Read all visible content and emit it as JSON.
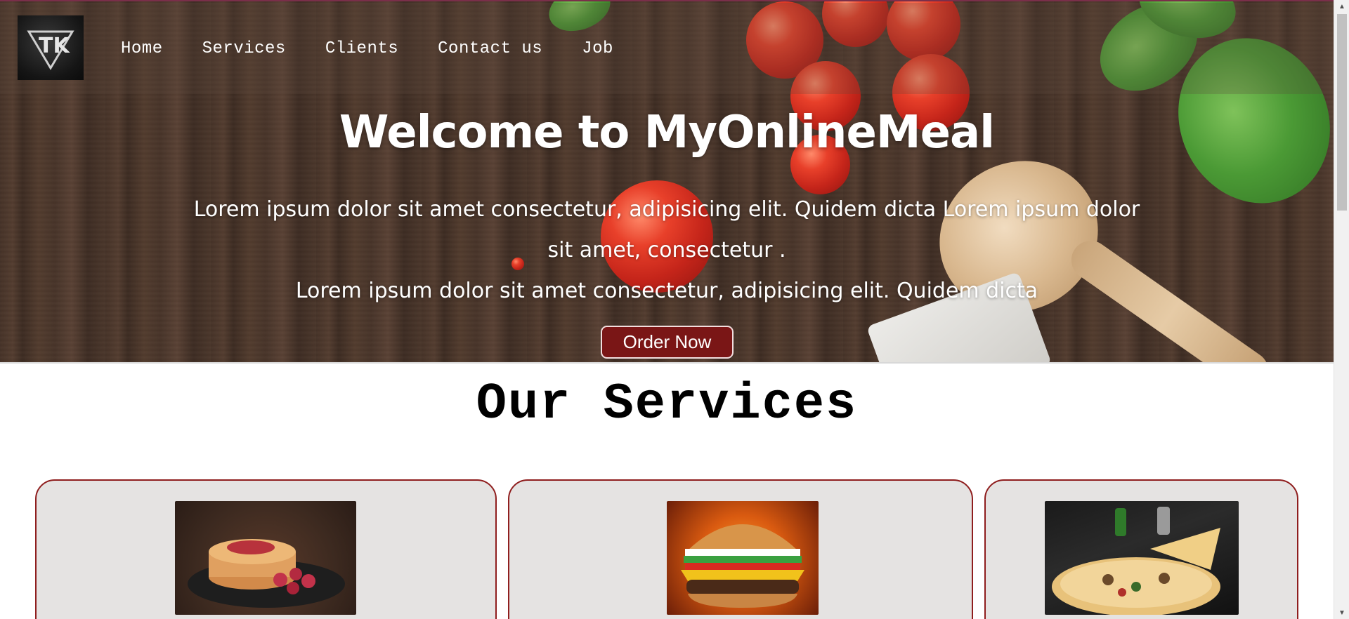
{
  "brand": {
    "logo_text": "TK",
    "logo_icon": "triangle-tk-logo"
  },
  "nav": {
    "items": [
      {
        "label": "Home"
      },
      {
        "label": "Services"
      },
      {
        "label": "Clients"
      },
      {
        "label": "Contact us"
      },
      {
        "label": "Job"
      }
    ]
  },
  "hero": {
    "title": "Welcome to MyOnlineMeal",
    "line1": "Lorem ipsum dolor sit amet consectetur, adipisicing elit. Quidem dicta Lorem ipsum dolor",
    "line2": "sit amet, consectetur .",
    "line3": "Lorem ipsum dolor sit amet consectetur, adipisicing elit. Quidem dicta",
    "cta_label": "Order Now"
  },
  "services": {
    "title": "Our Services",
    "cards": [
      {
        "image": "pancakes-image"
      },
      {
        "image": "burger-image"
      },
      {
        "image": "pizza-image"
      }
    ]
  },
  "colors": {
    "accent": "#7a1616",
    "card_border": "#8f1e1e",
    "card_bg": "#e5e3e2"
  }
}
